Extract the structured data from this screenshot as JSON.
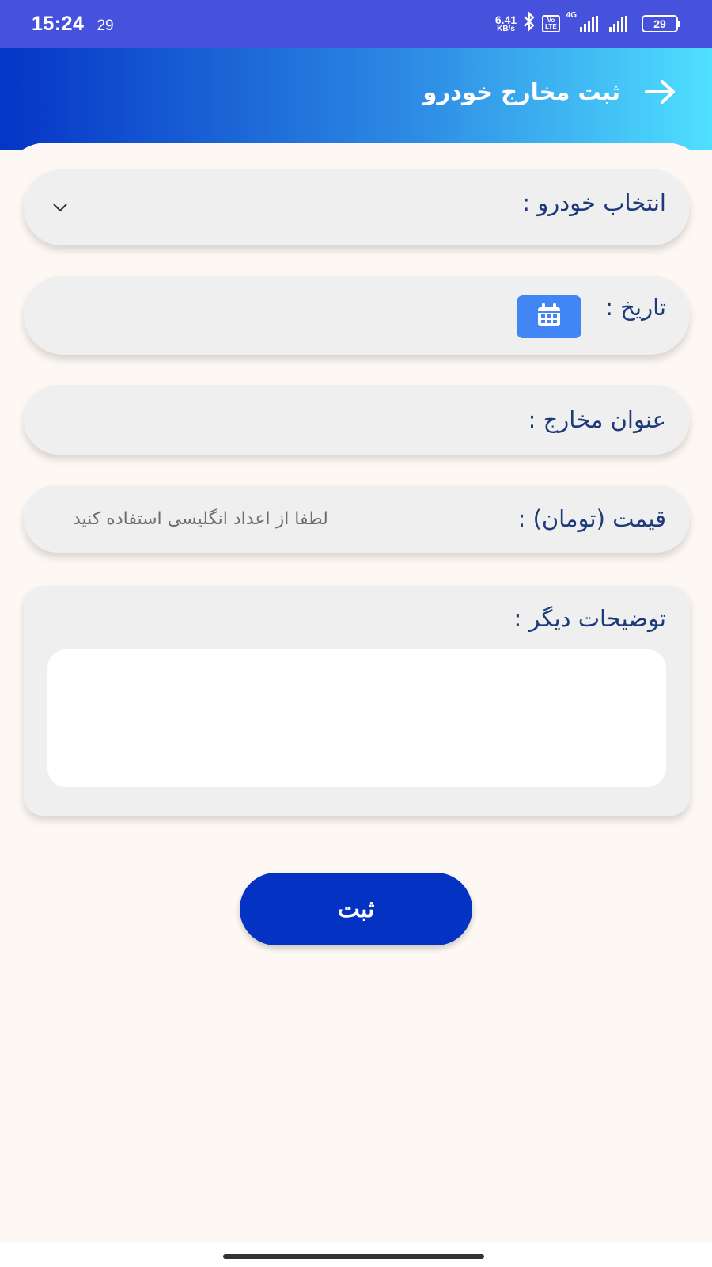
{
  "status_bar": {
    "time": "15:24",
    "notification_count": "29",
    "net_speed_value": "6.41",
    "net_speed_unit": "KB/s",
    "volte_top": "Vo",
    "volte_bottom": "LTE",
    "network_type": "4G",
    "battery": "29"
  },
  "header": {
    "title": "ثبت مخارج خودرو",
    "back_icon": "arrow-right-icon"
  },
  "form": {
    "car_select_label": "انتخاب خودرو :",
    "date_label": "تاریخ :",
    "date_icon": "calendar-icon",
    "expense_title_label": "عنوان مخارج :",
    "price_label": "قیمت (تومان) :",
    "price_placeholder": "لطفا از اعداد انگلیسی استفاده کنید",
    "notes_label": "توضیحات دیگر :",
    "notes_value": ""
  },
  "actions": {
    "submit_label": "ثبت"
  },
  "colors": {
    "primary": "#0433c3",
    "calendar_button": "#4285f4",
    "label_text": "#1d3a7a",
    "field_bg": "#efefef",
    "page_bg": "#fdf8f3"
  }
}
